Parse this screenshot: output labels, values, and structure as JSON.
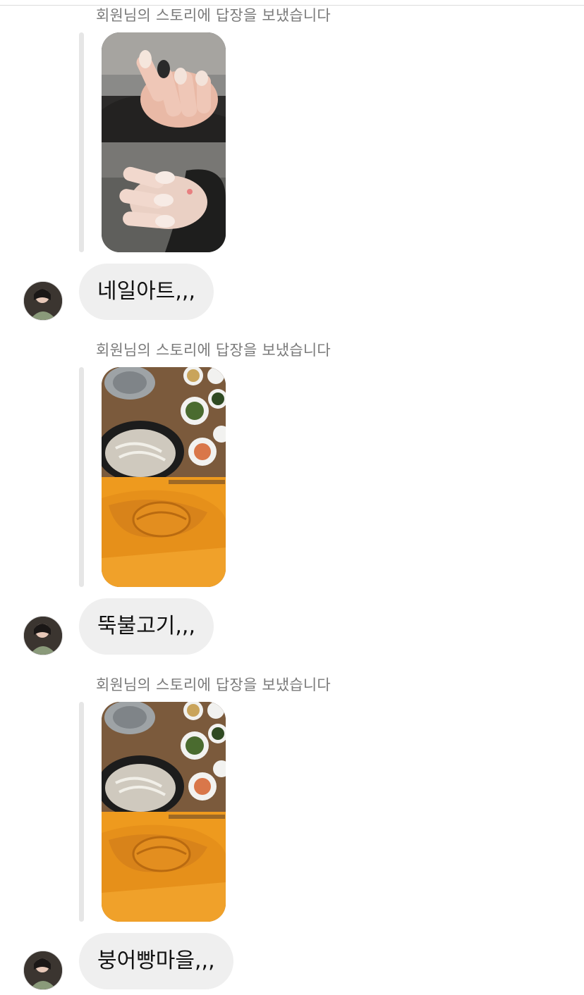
{
  "messages": [
    {
      "meta": "회원님의 스토리에 답장을 보냈습니다",
      "story": "nail-art-story",
      "text": "네일아트,,,"
    },
    {
      "meta": "회원님의 스토리에 답장을 보냈습니다",
      "story": "food-story",
      "text": "뚝불고기,,,"
    },
    {
      "meta": "회원님의 스토리에 답장을 보냈습니다",
      "story": "food-story",
      "text": "붕어빵마을,,,"
    }
  ],
  "colors": {
    "bubble_bg": "#efefef",
    "meta_text": "#7a7a7a",
    "story_line": "#e6e6e6"
  }
}
